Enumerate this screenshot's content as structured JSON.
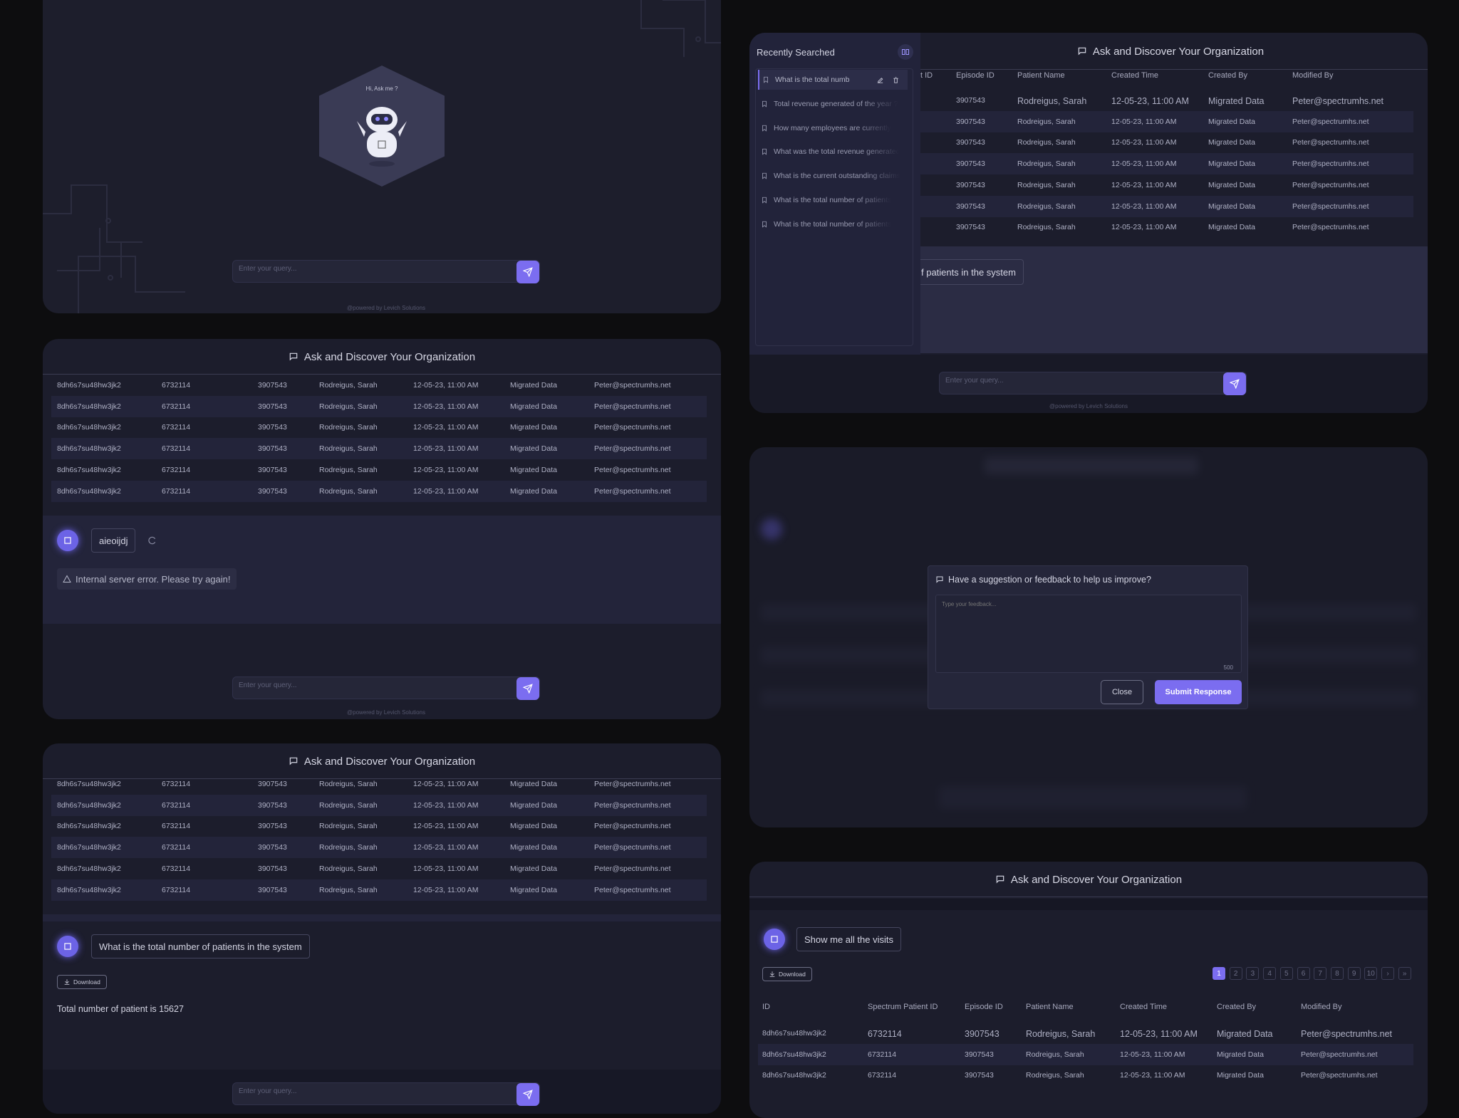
{
  "app_title": "Ask and Discover Your Organization",
  "greeting": "Hi, Ask me ?",
  "query_placeholder": "Enter your query...",
  "powered_by": "@powered by Levich Solutions",
  "table": {
    "columns": [
      "ID",
      "Spectrum Patient ID",
      "Episode ID",
      "Patient Name",
      "Created Time",
      "Created By",
      "Modified By"
    ],
    "row": [
      "8dh6s7su48hw3jk2",
      "6732114",
      "3907543",
      "Rodreigus, Sarah",
      "12-05-23, 11:00 AM",
      "Migrated Data",
      "Peter@spectrumhs.net"
    ]
  },
  "panel2": {
    "user_query": "aieoijdj",
    "error": "Internal server error. Please try again!"
  },
  "panel3": {
    "user_query": "What is the total number of patients in the system",
    "download": "Download",
    "answer": "Total number of patient is 15627"
  },
  "sidebar": {
    "title": "Recently Searched",
    "items": [
      "What is the total numb",
      "Total revenue generated of the year ?",
      "How many employees are currently",
      "What was the total revenue generated",
      "What is the current outstanding claims",
      "What is the total number of patients",
      "What is the total number of patients"
    ],
    "partial_col": "t ID",
    "behind_query": "f patients in the system"
  },
  "feedback": {
    "title": "Have a suggestion or feedback to help us improve?",
    "placeholder": "Type your feedback...",
    "counter": "500",
    "close": "Close",
    "submit": "Submit Response"
  },
  "panel6": {
    "user_query": "Show me all the visits",
    "download": "Download",
    "pages": [
      "1",
      "2",
      "3",
      "4",
      "5",
      "6",
      "7",
      "8",
      "9",
      "10"
    ],
    "next": "›",
    "last": "»"
  }
}
